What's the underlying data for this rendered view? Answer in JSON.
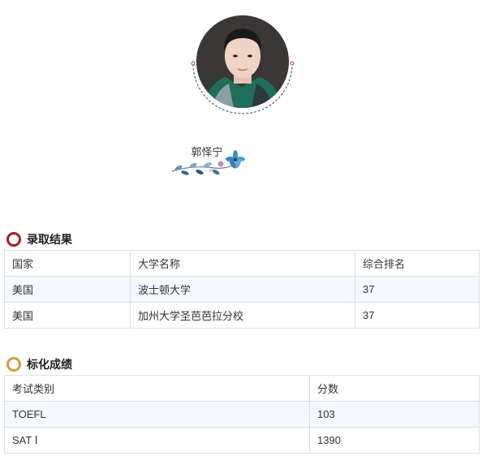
{
  "profile": {
    "name": "郭怿宁"
  },
  "admission": {
    "title": "录取结果",
    "icon_color": "#a41d24",
    "headers": [
      "国家",
      "大学名称",
      "综合排名"
    ],
    "rows": [
      [
        "美国",
        "波士顿大学",
        "37"
      ],
      [
        "美国",
        "加州大学圣芭芭拉分校",
        "37"
      ]
    ]
  },
  "scores": {
    "title": "标化成绩",
    "icon_color": "#c9a23a",
    "headers": [
      "考试类别",
      "分数"
    ],
    "rows": [
      [
        "TOEFL",
        "103"
      ],
      [
        "SAT Ⅰ",
        "1390"
      ]
    ]
  }
}
